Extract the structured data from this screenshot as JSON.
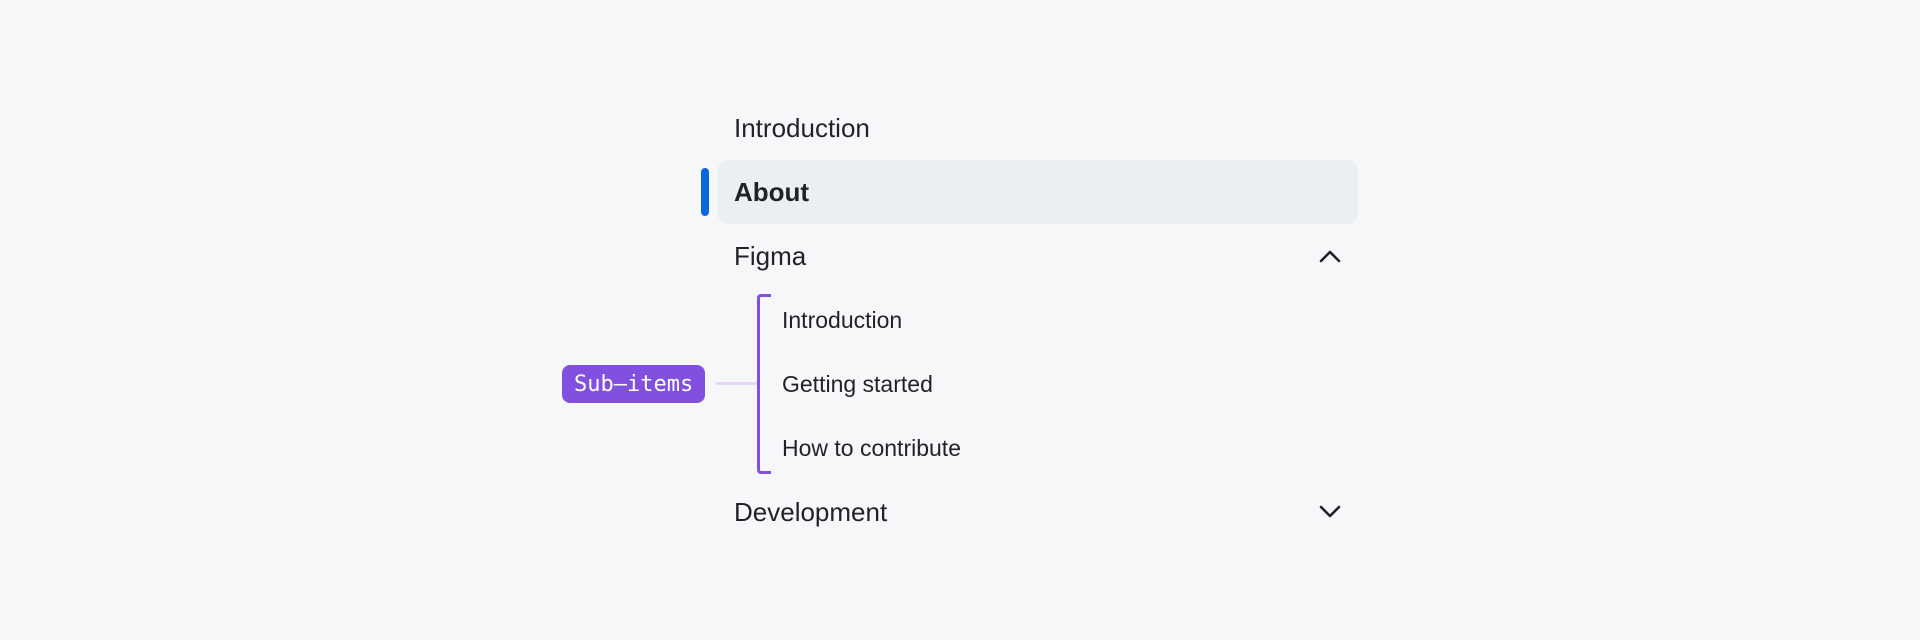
{
  "nav": {
    "items": [
      {
        "label": "Introduction"
      },
      {
        "label": "About",
        "active": true
      },
      {
        "label": "Figma",
        "expanded": true,
        "chevron": "chevron-up-icon"
      },
      {
        "label": "Development",
        "expanded": false,
        "chevron": "chevron-down-icon"
      }
    ],
    "figma_sub_items": [
      {
        "label": "Introduction"
      },
      {
        "label": "Getting started"
      },
      {
        "label": "How to contribute"
      }
    ]
  },
  "annotation": {
    "label": "Sub–items"
  },
  "colors": {
    "background": "#f6f7f9",
    "active_bg": "#eceff2",
    "active_indicator": "#0969da",
    "annotation": "#8250df",
    "text": "#1f2328"
  }
}
